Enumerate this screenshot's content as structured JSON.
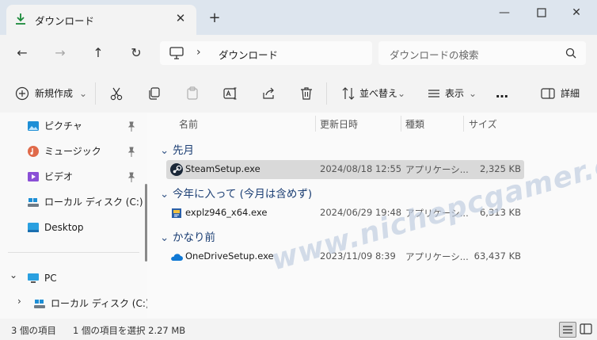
{
  "window": {
    "tab_title": "ダウンロード",
    "new_tab": "+"
  },
  "address": {
    "crumb": "ダウンロード",
    "search_placeholder": "ダウンロードの検索"
  },
  "toolbar": {
    "new": "新規作成",
    "sort": "並べ替え",
    "view": "表示",
    "more": "…",
    "details": "詳細"
  },
  "sidebar": {
    "items": [
      {
        "label": "ピクチャ"
      },
      {
        "label": "ミュージック"
      },
      {
        "label": "ビデオ"
      },
      {
        "label": "ローカル ディスク (C:)"
      },
      {
        "label": "Desktop"
      },
      {
        "label": "PC"
      },
      {
        "label": "ローカル ディスク (C:)"
      }
    ]
  },
  "columns": {
    "name": "名前",
    "date": "更新日時",
    "type": "種類",
    "size": "サイズ"
  },
  "groups": [
    {
      "title": "先月",
      "files": [
        {
          "name": "SteamSetup.exe",
          "date": "2024/08/18 12:55",
          "type": "アプリケーシ...",
          "size": "2,325 KB"
        }
      ]
    },
    {
      "title": "今年に入って (今月は含めず)",
      "files": [
        {
          "name": "explz946_x64.exe",
          "date": "2024/06/29 19:48",
          "type": "アプリケーシ...",
          "size": "6,313 KB"
        }
      ]
    },
    {
      "title": "かなり前",
      "files": [
        {
          "name": "OneDriveSetup.exe",
          "date": "2023/11/09 8:39",
          "type": "アプリケーシ...",
          "size": "63,437 KB"
        }
      ]
    }
  ],
  "status": {
    "count": "3 個の項目",
    "selection": "1 個の項目を選択  2.27 MB"
  },
  "watermark": "www.nichepcgamer.com",
  "colors": {
    "titlebar": "#dde5ee",
    "selected_row": "#d9d9d9",
    "group_text": "#1c3f74",
    "accent": "#0067c0"
  }
}
